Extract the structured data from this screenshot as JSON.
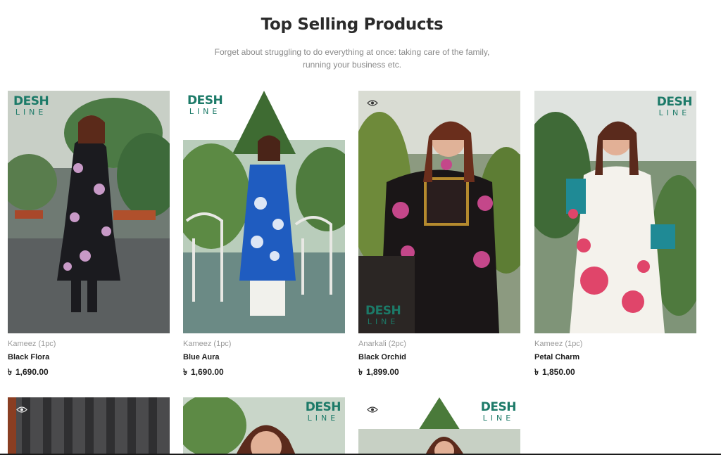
{
  "section": {
    "title": "Top Selling Products",
    "subtitle": "Forget about struggling to do everything at once: taking care of the family, running your business etc."
  },
  "brand": {
    "line1": "DESH",
    "line2": "LINE"
  },
  "currency_symbol": "৳",
  "colors": {
    "brand_green": "#1c7a68",
    "title": "#2b2b2b",
    "muted": "#9a9a9a"
  },
  "products": [
    {
      "category": "Kameez (1pc)",
      "name": "Black Flora",
      "price": "1,690.00"
    },
    {
      "category": "Kameez (1pc)",
      "name": "Blue Aura",
      "price": "1,690.00"
    },
    {
      "category": "Anarkali (2pc)",
      "name": "Black Orchid",
      "price": "1,899.00"
    },
    {
      "category": "Kameez (1pc)",
      "name": "Petal Charm",
      "price": "1,850.00"
    }
  ],
  "icons": {
    "quick_view": "eye-icon"
  }
}
